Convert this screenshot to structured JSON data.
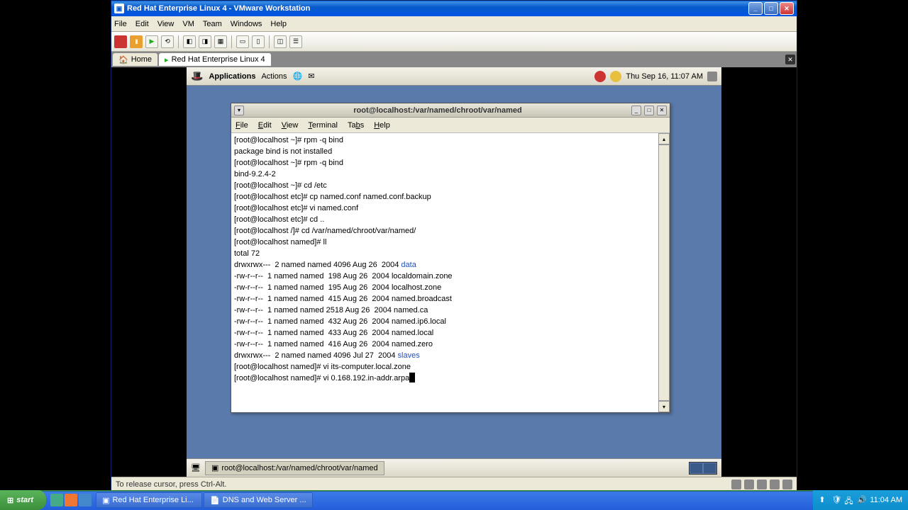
{
  "vmware": {
    "title": "Red Hat Enterprise Linux 4 - VMware Workstation",
    "menu": [
      "File",
      "Edit",
      "View",
      "VM",
      "Team",
      "Windows",
      "Help"
    ],
    "tabs": {
      "home": "Home",
      "vm": "Red Hat Enterprise Linux 4"
    },
    "status": "To release cursor, press Ctrl-Alt."
  },
  "gnome": {
    "apps": "Applications",
    "actions": "Actions",
    "clock": "Thu Sep 16, 11:07 AM",
    "task": "root@localhost:/var/named/chroot/var/named"
  },
  "terminal": {
    "title": "root@localhost:/var/named/chroot/var/named",
    "menu": {
      "file": "File",
      "edit": "Edit",
      "view": "View",
      "term": "Terminal",
      "tabs": "Tabs",
      "help": "Help"
    },
    "lines": [
      "[root@localhost ~]# rpm -q bind",
      "package bind is not installed",
      "[root@localhost ~]# rpm -q bind",
      "bind-9.2.4-2",
      "[root@localhost ~]# cd /etc",
      "[root@localhost etc]# cp named.conf named.conf.backup",
      "[root@localhost etc]# vi named.conf",
      "[root@localhost etc]# cd ..",
      "[root@localhost /]# cd /var/named/chroot/var/named/",
      "[root@localhost named]# ll",
      "total 72",
      {
        "pre": "drwxrwx---  2 named named 4096 Aug 26  2004 ",
        "dir": "data"
      },
      "-rw-r--r--  1 named named  198 Aug 26  2004 localdomain.zone",
      "-rw-r--r--  1 named named  195 Aug 26  2004 localhost.zone",
      "-rw-r--r--  1 named named  415 Aug 26  2004 named.broadcast",
      "-rw-r--r--  1 named named 2518 Aug 26  2004 named.ca",
      "-rw-r--r--  1 named named  432 Aug 26  2004 named.ip6.local",
      "-rw-r--r--  1 named named  433 Aug 26  2004 named.local",
      "-rw-r--r--  1 named named  416 Aug 26  2004 named.zero",
      {
        "pre": "drwxrwx---  2 named named 4096 Jul 27  2004 ",
        "dir": "slaves"
      },
      "[root@localhost named]# vi its-computer.local.zone",
      {
        "prompt": "[root@localhost named]# vi 0.168.192.in-addr.arpa",
        "cursor": true
      }
    ]
  },
  "xp": {
    "start": "start",
    "tasks": [
      "Red Hat Enterprise Li...",
      "DNS and Web Server ..."
    ],
    "clock": "11:04 AM"
  }
}
